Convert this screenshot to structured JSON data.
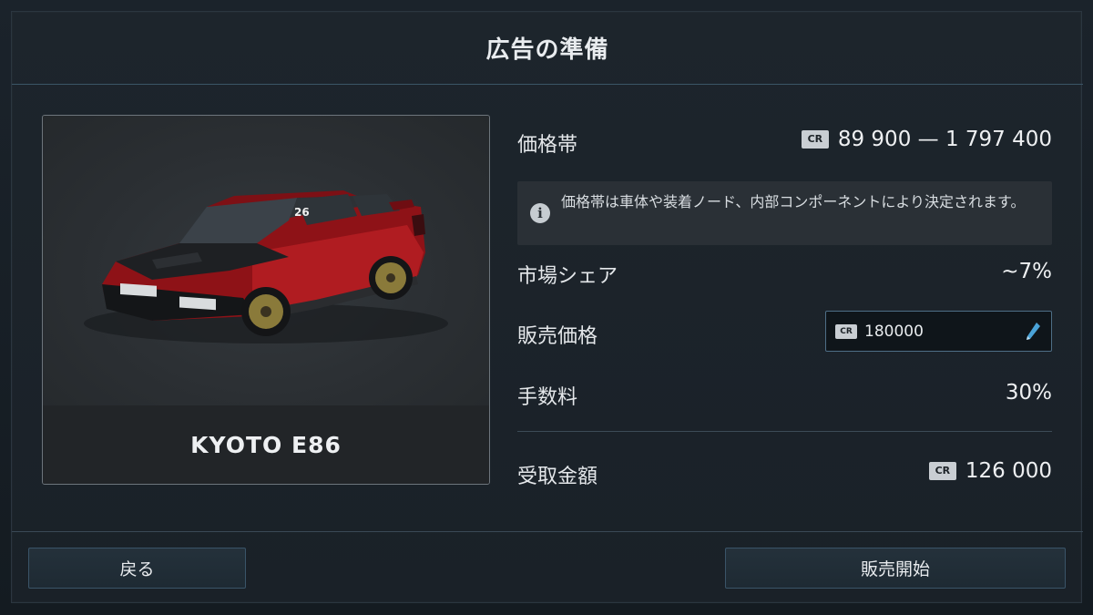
{
  "header": {
    "title": "広告の準備"
  },
  "car": {
    "name": "KYOTO E86",
    "decal_number": "26"
  },
  "currency_icon": "CR",
  "rows": {
    "price_range": {
      "label": "価格帯",
      "value": "89 900 — 1 797 400"
    },
    "info": {
      "icon": "info-icon",
      "text": "価格帯は車体や装着ノード、内部コンポーネントにより決定されます。"
    },
    "market_share": {
      "label": "市場シェア",
      "value": "~7%"
    },
    "sale_price": {
      "label": "販売価格",
      "value": "180000"
    },
    "fee": {
      "label": "手数料",
      "value": "30%"
    },
    "received": {
      "label": "受取金額",
      "value": "126 000"
    }
  },
  "buttons": {
    "back": "戻る",
    "start_sale": "販売開始"
  },
  "colors": {
    "accent_border": "#4e6e86",
    "panel_bg": "#1d252c",
    "car_body": "#a3161b"
  }
}
